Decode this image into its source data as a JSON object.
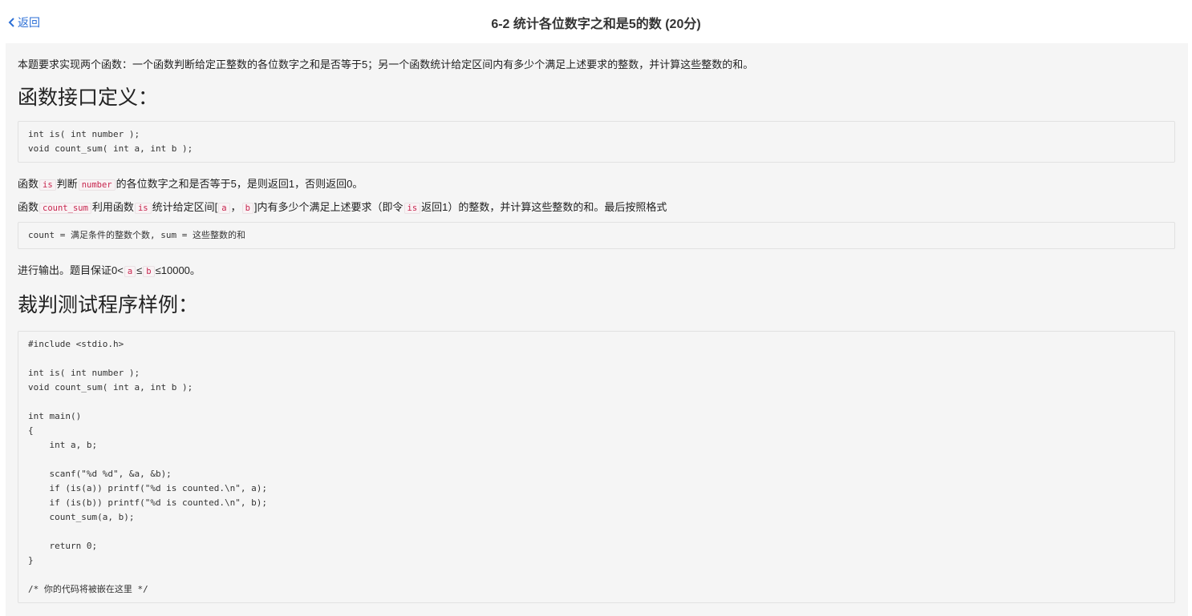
{
  "header": {
    "back_label": "返回",
    "title": "6-2 统计各位数字之和是5的数 (20分)"
  },
  "problem": {
    "intro": "本题要求实现两个函数：一个函数判断给定正整数的各位数字之和是否等于5；另一个函数统计给定区间内有多少个满足上述要求的整数，并计算这些整数的和。",
    "section_interface": "函数接口定义：",
    "interface_code": "int is( int number );\nvoid count_sum( int a, int b );",
    "desc1": {
      "p1": "函数",
      "c1": "is",
      "p2": "判断",
      "c2": "number",
      "p3": "的各位数字之和是否等于5，是则返回1，否则返回0。"
    },
    "desc2": {
      "p1": "函数",
      "c1": "count_sum",
      "p2": "利用函数",
      "c2": "is",
      "p3": "统计给定区间[",
      "c3": "a",
      "p4": "，",
      "c4": "b",
      "p5": "]内有多少个满足上述要求（即令",
      "c5": "is",
      "p6": "返回1）的整数，并计算这些整数的和。最后按照格式"
    },
    "format_code": "count = 满足条件的整数个数, sum = 这些整数的和",
    "desc3": {
      "p1": "进行输出。题目保证0<",
      "c1": "a",
      "p2": "≤",
      "c2": "b",
      "p3": "≤10000。"
    },
    "section_sample": "裁判测试程序样例：",
    "sample_code": "#include <stdio.h>\n\nint is( int number );\nvoid count_sum( int a, int b );\n\nint main()\n{\n    int a, b;\n\n    scanf(\"%d %d\", &a, &b);\n    if (is(a)) printf(\"%d is counted.\\n\", a);\n    if (is(b)) printf(\"%d is counted.\\n\", b);\n    count_sum(a, b);\n\n    return 0;\n}\n\n/* 你的代码将被嵌在这里 */"
  }
}
